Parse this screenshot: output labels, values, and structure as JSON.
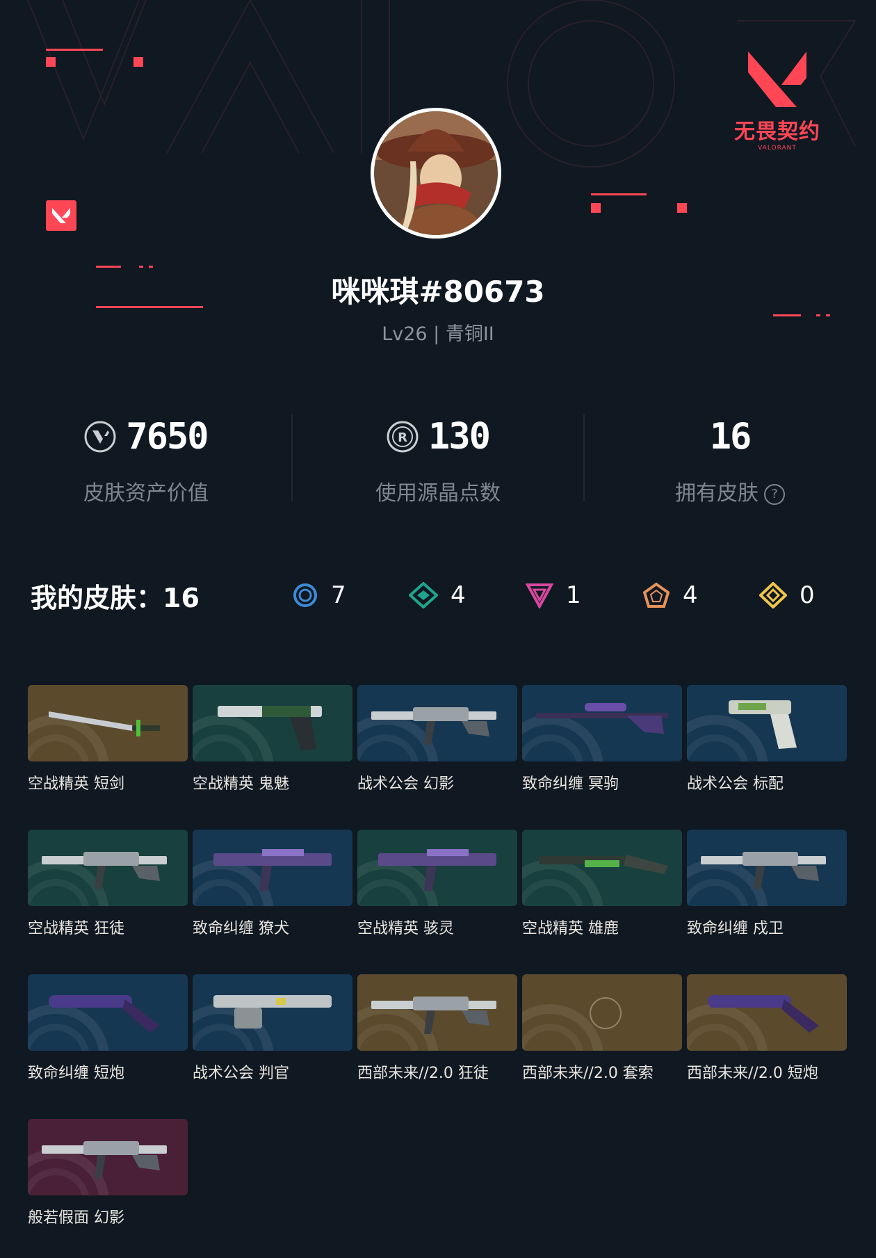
{
  "brand": {
    "logo_text": "无畏契约",
    "logo_sub": "VALORANT"
  },
  "player": {
    "name": "咪咪琪#80673",
    "level": "Lv26 | 青铜II"
  },
  "stats": [
    {
      "icon": "valorant-points-icon",
      "value": "7650",
      "label": "皮肤资产价值"
    },
    {
      "icon": "radianite-icon",
      "value": "130",
      "label": "使用源晶点数"
    },
    {
      "icon": "",
      "value": "16",
      "label": "拥有皮肤"
    }
  ],
  "skins": {
    "title": "我的皮肤：16",
    "tiers": [
      {
        "icon": "select-tier-icon",
        "color": "#3d8bd6",
        "count": "7"
      },
      {
        "icon": "deluxe-tier-icon",
        "color": "#1fa58e",
        "count": "4"
      },
      {
        "icon": "premium-tier-icon",
        "color": "#d8489e",
        "count": "1"
      },
      {
        "icon": "ultra-tier-icon",
        "color": "#e6935a",
        "count": "4"
      },
      {
        "icon": "exclusive-tier-icon",
        "color": "#f0c64a",
        "count": "0"
      }
    ],
    "items": [
      {
        "label": "空战精英 短剑",
        "bg": "#5c4a2c",
        "weapon": "knife"
      },
      {
        "label": "空战精英 鬼魅",
        "bg": "#17403e",
        "weapon": "pistol"
      },
      {
        "label": "战术公会 幻影",
        "bg": "#163752",
        "weapon": "rifle"
      },
      {
        "label": "致命纠缠 冥驹",
        "bg": "#163752",
        "weapon": "sniper"
      },
      {
        "label": "战术公会 标配",
        "bg": "#163752",
        "weapon": "handgun"
      },
      {
        "label": "空战精英 狂徒",
        "bg": "#17403e",
        "weapon": "rifle"
      },
      {
        "label": "致命纠缠 獠犬",
        "bg": "#163752",
        "weapon": "smg"
      },
      {
        "label": "空战精英 骇灵",
        "bg": "#17403e",
        "weapon": "smg"
      },
      {
        "label": "空战精英 雄鹿",
        "bg": "#17403e",
        "weapon": "shotgun"
      },
      {
        "label": "致命纠缠 戍卫",
        "bg": "#163752",
        "weapon": "rifle"
      },
      {
        "label": "致命纠缠 短炮",
        "bg": "#163752",
        "weapon": "shorty"
      },
      {
        "label": "战术公会 判官",
        "bg": "#163752",
        "weapon": "judge"
      },
      {
        "label": "西部未来//2.0 狂徒",
        "bg": "#5c4a2c",
        "weapon": "rifle"
      },
      {
        "label": "西部未来//2.0 套索",
        "bg": "#5c4a2c",
        "weapon": "none"
      },
      {
        "label": "西部未来//2.0 短炮",
        "bg": "#5c4a2c",
        "weapon": "shorty"
      },
      {
        "label": "般若假面 幻影",
        "bg": "#4a2037",
        "weapon": "rifle"
      }
    ]
  },
  "colors": {
    "accent": "#ff4655",
    "background": "#101822",
    "muted_text": "#7e8790"
  }
}
